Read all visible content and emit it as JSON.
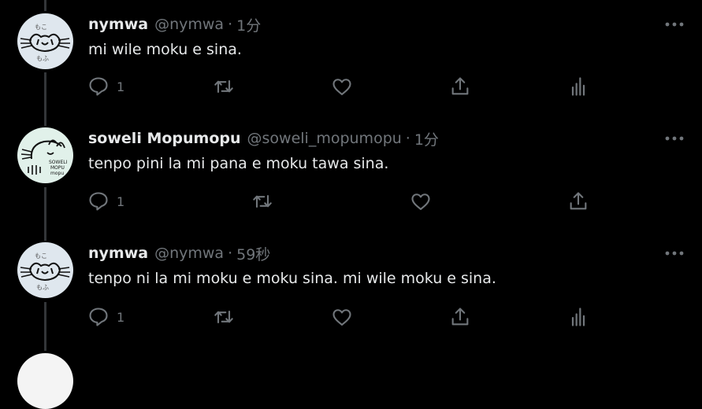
{
  "tweets": [
    {
      "name": "nymwa",
      "handle": "@nymwa",
      "separator": "·",
      "time": "1分",
      "text": "mi wile moku e sina.",
      "reply_count": "1",
      "show_stats": true
    },
    {
      "name": "soweli Mopumopu",
      "handle": "@soweli_mopumopu",
      "separator": "·",
      "time": "1分",
      "text": "tenpo pini la mi pana e moku tawa sina.",
      "reply_count": "1",
      "show_stats": false
    },
    {
      "name": "nymwa",
      "handle": "@nymwa",
      "separator": "·",
      "time": "59秒",
      "text": "tenpo ni la mi moku e moku sina. mi wile moku e sina.",
      "reply_count": "1",
      "show_stats": true
    }
  ],
  "icons": {
    "reply": "reply-icon",
    "retweet": "retweet-icon",
    "like": "heart-icon",
    "share": "share-icon",
    "stats": "stats-icon",
    "more": "more-icon"
  },
  "colors": {
    "background": "#000000",
    "text": "#e7e9ea",
    "muted": "#71767b",
    "thread_line": "#333639"
  }
}
